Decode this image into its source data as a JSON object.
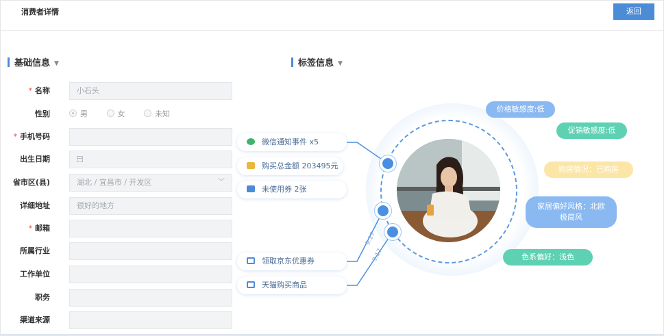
{
  "header": {
    "title": "消费者详情",
    "back_label": "返回"
  },
  "basic": {
    "title": "基础信息",
    "fields": {
      "name": {
        "label": "名称",
        "value": "小石头",
        "required": true
      },
      "gender": {
        "label": "性别",
        "options": [
          "男",
          "女",
          "未知"
        ],
        "selected": "男"
      },
      "phone": {
        "label": "手机号码",
        "value": "",
        "required": true
      },
      "birth": {
        "label": "出生日期",
        "value": ""
      },
      "region": {
        "label": "省市区(县)",
        "value": "湖北 / 宜昌市 / 开发区"
      },
      "address": {
        "label": "详细地址",
        "value": "很好的地方"
      },
      "email": {
        "label": "邮箱",
        "value": "",
        "required": true
      },
      "industry": {
        "label": "所属行业",
        "value": ""
      },
      "company": {
        "label": "工作单位",
        "value": ""
      },
      "position": {
        "label": "职务",
        "value": ""
      },
      "source": {
        "label": "渠道来源",
        "value": ""
      }
    },
    "required_mark": "*"
  },
  "tags": {
    "title": "标签信息",
    "events": [
      {
        "label": "微信通知事件 x5",
        "icon": "wechat-icon"
      },
      {
        "label": "购买总金额 203495元",
        "icon": "money-bag-icon"
      },
      {
        "label": "未使用券 2张",
        "icon": "coupon-icon"
      },
      {
        "label": "领取京东优惠券",
        "icon": "monitor-icon"
      },
      {
        "label": "天猫购买商品",
        "icon": "monitor-icon"
      }
    ],
    "dates": [
      "9.17",
      "9.17"
    ],
    "labels": [
      {
        "text": "价格敏感度:低",
        "color": "#8ab9f2"
      },
      {
        "text": "促销敏感度:低",
        "color": "#5ed1b3"
      },
      {
        "text": "购房情况：已购房",
        "color": "#fbe6a8"
      },
      {
        "text": "家居偏好风格：北欧极简风",
        "line1": "家居偏好风格：北欧",
        "line2": "极简风",
        "color": "#8ab9f2"
      },
      {
        "text": "色系偏好：浅色",
        "color": "#5ed1b3"
      }
    ]
  },
  "colors": {
    "accent": "#4c8bd6",
    "required": "#e84c3d"
  }
}
